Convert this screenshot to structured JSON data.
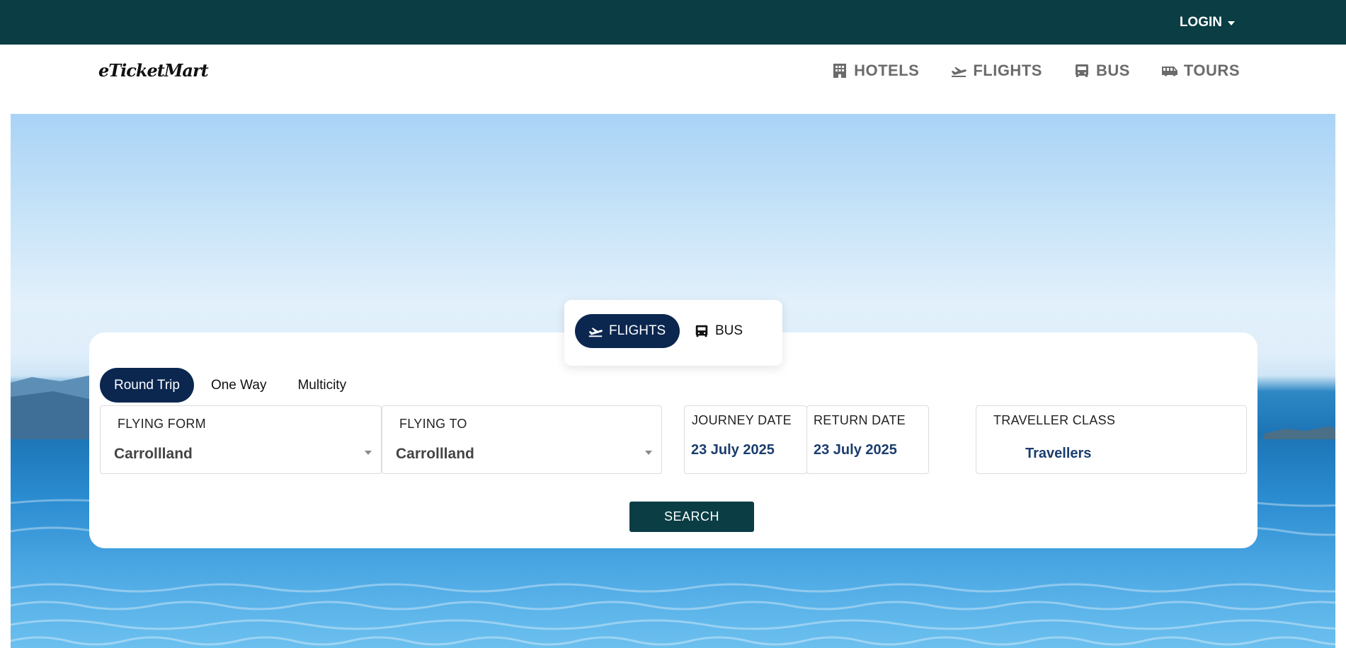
{
  "topbar": {
    "login_label": "LOGIN"
  },
  "navbar": {
    "logo": "eTicketMart",
    "links": [
      {
        "label": "HOTELS",
        "icon": "hotel-icon"
      },
      {
        "label": "FLIGHTS",
        "icon": "plane-icon"
      },
      {
        "label": "BUS",
        "icon": "bus-icon"
      },
      {
        "label": "TOURS",
        "icon": "tour-bus-icon"
      }
    ]
  },
  "search": {
    "modes": [
      {
        "label": "FLIGHTS",
        "icon": "plane-icon",
        "active": true
      },
      {
        "label": "BUS",
        "icon": "bus-icon",
        "active": false
      }
    ],
    "trip_types": [
      {
        "label": "Round Trip",
        "active": true
      },
      {
        "label": "One Way",
        "active": false
      },
      {
        "label": "Multicity",
        "active": false
      }
    ],
    "flying_from": {
      "label": "FLYING FORM",
      "value": "Carrollland"
    },
    "flying_to": {
      "label": "FLYING TO",
      "value": "Carrollland"
    },
    "journey_date": {
      "label": "JOURNEY DATE",
      "value": "23 July 2025"
    },
    "return_date": {
      "label": "RETURN DATE",
      "value": "23 July 2025"
    },
    "traveller_class": {
      "label": "TRAVELLER CLASS",
      "value": "Travellers"
    },
    "search_label": "SEARCH"
  },
  "colors": {
    "topbar": "#0a3d44",
    "active_pill": "#0b2750",
    "search_button": "#0a3d44",
    "date_text": "#1a3d6e"
  }
}
